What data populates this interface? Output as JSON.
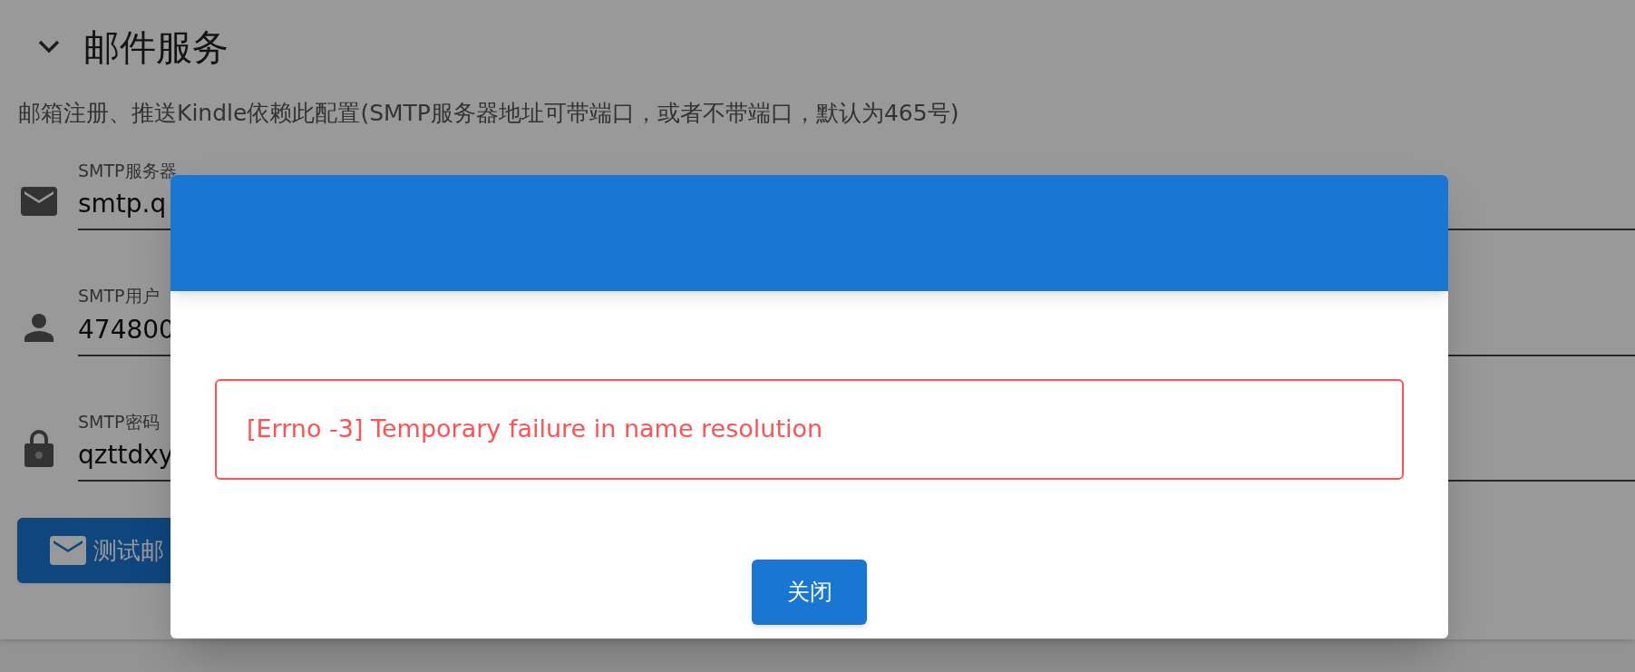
{
  "section": {
    "title": "邮件服务",
    "expanded": true,
    "description": "邮箱注册、推送Kindle依赖此配置(SMTP服务器地址可带端口，或者不带端口，默认为465号)"
  },
  "fields": [
    {
      "kind": "mail",
      "label": "SMTP服务器",
      "value": "smtp.q"
    },
    {
      "kind": "user",
      "label": "SMTP用户",
      "value": "474800"
    },
    {
      "kind": "lock",
      "label": "SMTP密码",
      "value": "qzttdxy"
    }
  ],
  "test_button": {
    "label": "测试邮"
  },
  "dialog": {
    "message": "[Errno -3] Temporary failure in name resolution",
    "close_button": "关闭"
  }
}
